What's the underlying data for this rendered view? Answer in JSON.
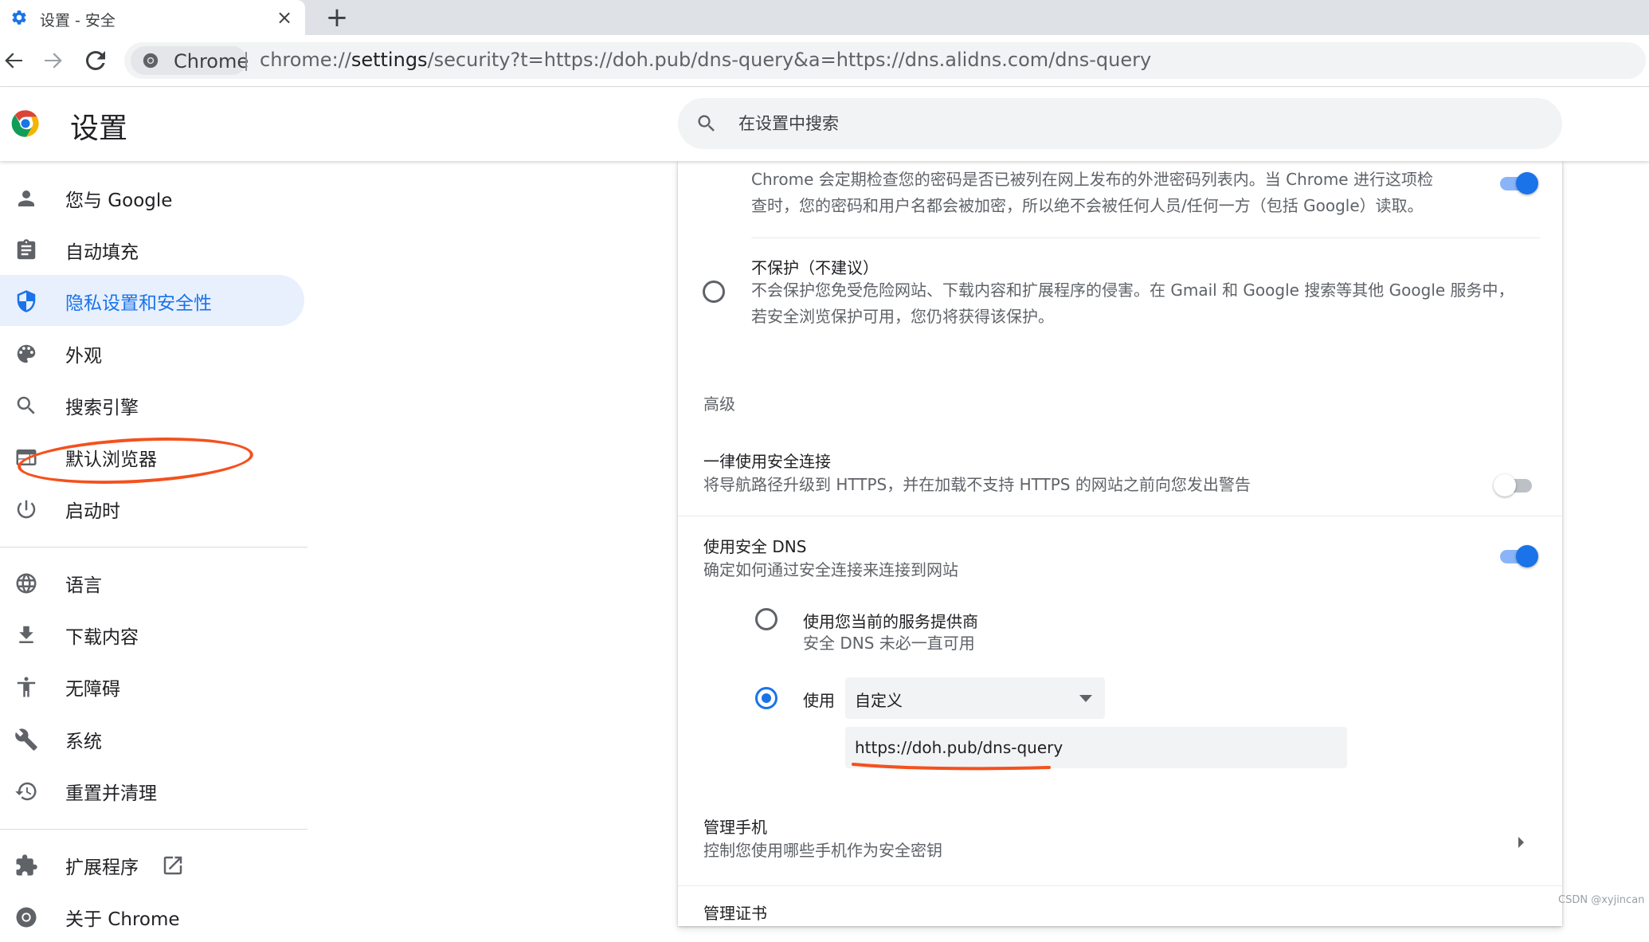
{
  "tab": {
    "title": "设置 - 安全",
    "close_glyph": "×",
    "new_tab_glyph": "+"
  },
  "toolbar": {
    "chip_label": "Chrome",
    "url_prefix": "chrome://",
    "url_host": "settings",
    "url_rest": "/security?t=https://doh.pub/dns-query&a=https://dns.alidns.com/dns-query"
  },
  "header": {
    "title": "设置",
    "search_placeholder": "在设置中搜索"
  },
  "sidebar": {
    "items": [
      {
        "label": "您与 Google",
        "icon": "person-icon"
      },
      {
        "label": "自动填充",
        "icon": "clipboard-icon"
      },
      {
        "label": "隐私设置和安全性",
        "icon": "shield-icon",
        "active": true
      },
      {
        "label": "外观",
        "icon": "palette-icon"
      },
      {
        "label": "搜索引擎",
        "icon": "search-icon"
      },
      {
        "label": "默认浏览器",
        "icon": "browser-icon"
      },
      {
        "label": "启动时",
        "icon": "power-icon"
      },
      {
        "label": "语言",
        "icon": "globe-icon"
      },
      {
        "label": "下载内容",
        "icon": "download-icon"
      },
      {
        "label": "无障碍",
        "icon": "accessibility-icon"
      },
      {
        "label": "系统",
        "icon": "wrench-icon"
      },
      {
        "label": "重置并清理",
        "icon": "history-icon"
      },
      {
        "label": "扩展程序",
        "icon": "puzzle-icon"
      },
      {
        "label": "关于 Chrome",
        "icon": "chrome-icon"
      }
    ]
  },
  "main": {
    "password_warning": {
      "desc_line1": "Chrome 会定期检查您的密码是否已被列在网上发布的外泄密码列表内。当 Chrome 进行这项检",
      "desc_line2": "查时，您的密码和用户名都会被加密，所以绝不会被任何人员/任何一方（包括 Google）读取。",
      "enabled": true
    },
    "no_protection": {
      "title": "不保护（不建议）",
      "desc_line1": "不会保护您免受危险网站、下载内容和扩展程序的侵害。在 Gmail 和 Google 搜索等其他 Google 服务中，",
      "desc_line2": "若安全浏览保护可用，您仍将获得该保护。"
    },
    "advanced_heading": "高级",
    "https_first": {
      "title": "一律使用安全连接",
      "desc": "将导航路径升级到 HTTPS，并在加载不支持 HTTPS 的网站之前向您发出警告",
      "enabled": false
    },
    "secure_dns": {
      "title": "使用安全 DNS",
      "desc": "确定如何通过安全连接来连接到网站",
      "enabled": true,
      "option_current_title": "使用您当前的服务提供商",
      "option_current_desc": "安全 DNS 未必一直可用",
      "option_use_label": "使用",
      "select_value": "自定义",
      "custom_value": "https://doh.pub/dns-query"
    },
    "manage_phones": {
      "title": "管理手机",
      "desc": "控制您使用哪些手机作为安全密钥"
    },
    "manage_certs": {
      "title": "管理证书"
    }
  },
  "colors": {
    "accent": "#1a73e8",
    "annotation": "#f4511e"
  },
  "watermark": "CSDN @xyjincan"
}
